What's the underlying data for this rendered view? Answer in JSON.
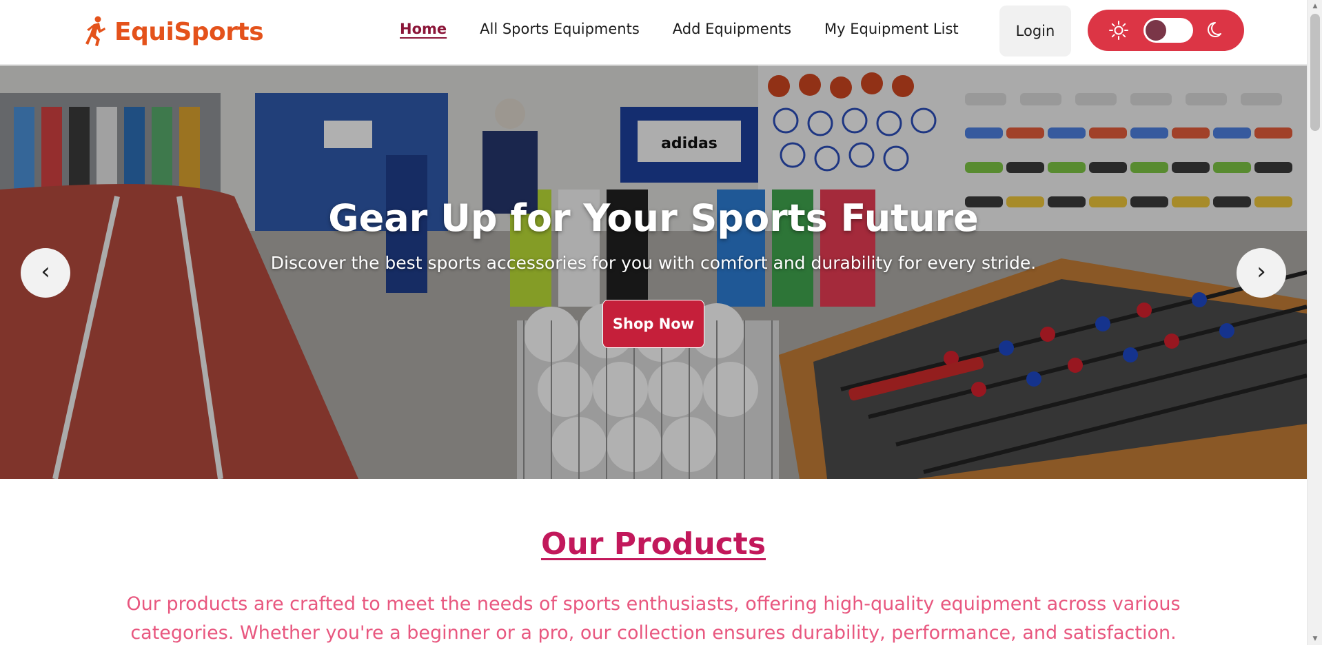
{
  "brand": {
    "name": "EquiSports",
    "color": "#e4521b",
    "icon": "athlete-icon"
  },
  "nav": {
    "links": [
      {
        "label": "Home",
        "active": true
      },
      {
        "label": "All Sports Equipments",
        "active": false
      },
      {
        "label": "Add Equipments",
        "active": false
      },
      {
        "label": "My Equipment List",
        "active": false
      }
    ],
    "login_label": "Login",
    "theme_toggle": {
      "light_icon": "sun-icon",
      "dark_icon": "moon-icon",
      "state": "light",
      "color": "#dc3545"
    }
  },
  "hero": {
    "title": "Gear Up for Your Sports Future",
    "subtitle": "Discover the best sports accessories for you with comfort and durability for every stride.",
    "cta_label": "Shop Now",
    "cta_color": "#c51f3a",
    "prev_label": "‹",
    "next_label": "›",
    "background_sign": "adidas"
  },
  "products": {
    "heading": "Our Products",
    "heading_color": "#c2185b",
    "description": "Our products are crafted to meet the needs of sports enthusiasts, offering high-quality equipment across various categories. Whether you're a beginner or a pro, our collection ensures durability, performance, and satisfaction.",
    "description_color": "#e8577f"
  }
}
